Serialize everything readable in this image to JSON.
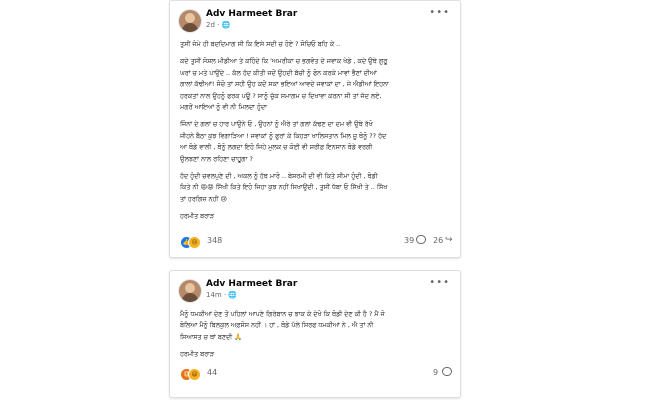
{
  "posts": [
    {
      "author": "Adv Harmeet Brar",
      "time": "2d",
      "audience_icon": "public-globe-icon",
      "lines": [
        "ਤੁਸੀਂ ਜੰਮੇ ਹੀ ਬਦਦਿਮਾਗ ਸੀ ਕਿ ਇਸੇ ਸਦੀ ਚ ਹੋਏ ? ਸੋਚਿਓ ਬਹਿ ਕੇ ..",
        "",
        "ਕਦੇ ਤੁਸੀਂ ਸੋਸ਼ਲ ਮੀਡੀਆ ਤੇ ਕਹਿੰਦੇ ਕਿ 'ਅਮਰੀਕਾ ਚ ਭਗਵੰਤ ਦੇ ਜਵਾਕ ਖੇਡੇ , ਕਦੇ ਉਥੇ ਗੁਰੂ",
        "ਘਰਾਂ ਚ ਮਤੇ ਪਾਉਂਦੇ .. ਕੱਲ ਹੱਦ ਕੀਤੀ ਜਦੋਂ ਉਹਦੀ ਬੱਚੀ ਨੂੰ ਫੋਨ ਕਰਕੇ ਮਾਵਾਂ ਭੈਣਾਂ ਦੀਆਂ",
        "ਗਾਲਾਂ ਕੱਢੀਆਂ! ਸੋਚੋ ਤਾਂ ਸਹੀ ਉਹ ਕਦੋਂ ਸਕਾ ਭਇਆਂ ਆਵਦੇ ਜਵਾਕਾਂ ਦਾ , ਜੇ ਐਡੀਆਂ ਇਹਨਾ",
        "ਹਰਕਤਾਂ ਨਾਲ ਉਹਨੂੰ ਫਰਕ ਪਊ ? ਸਾਨੂੰ ਚੁੱਕ ਸਮਾਗਮ ਚ ਦਿਖਾਵਾ ਕਰਨਾ ਸੀ ਤਾਂ ਜੱਦ ਲਏ,",
        "ਮਗਰੋਂ ਆਇਆਂ ਨੂੰ ਵੀ ਨੀ ਮਿਲਦਾ ਹੁੰਦਾ",
        "",
        "ਜਿੰਨਾਂ ਦੇ ਗਲਾਂ ਚ ਹਾਰ ਪਾਉਨੇ ਓ , ਉਹਨਾਂ ਨੂੰ ਐਰੇ ਤਾਂ ਗਲਾਂ ਕੱਢਣ ਦਾ ਦਮ ਵੀ ਉਥੇ ਰੱਖੋ",
        "ਜੀਹਨੇ ਬੈਠਾ ਕੁਝ ਵਿਗਾੜਿਆ ! ਜਵਾਕਾਂ ਨੂੰ ਫੁਰਾਂ ਕੇ ਕਿਹੜਾ ਖਾਲਿਸਤਾਨ ਮਿਲ ਜੂ ਥੋਨੂੰ ?? ਹੱਦ",
        "ਆ ਥੋਡੇ ਵਾਲੀ , ਥੋਨੂੰ ਲਗਦਾ ਇਹੋ ਜਿਹੇ ਮੁਲਕ ਚ ਕੋਈ ਵੀ ਸ਼ਰੀਫ਼ ਇਨਸਾਨ ਥੋਡੇ ਵਰਗੀ",
        "ਉਲਝਣਾਂ ਨਾਲ ਰਹਿਣਾ ਚਾਹੂਗਾ ?",
        "",
        "ਹੱਦ ਹੁੰਦੀ ਚਵਲਪੁਣੇ ਦੀ , ਅਕਲ ਨੂੰ ਹੱਥ ਮਾਰੋ .. ਬੇਸ਼ਰਮੀ ਦੀ ਵੀ ਕਿਤੇ ਸੀਮਾ ਹੁੰਦੀ , ਥੋਡੀ",
        "ਕਿਤੇ ਨੀ 😡😡 ਸਿੱਖੀ ਕਿਤੇ ਇਹੋ ਜਿਹਾ ਕੁਝ ਨਹੀਂ ਸਿਖਾਉਂਦੀ , ਤੁਸੀਂ ਧੱਬਾ ਓ ਸਿੱਖੀ ਤੇ .. ਸਿੱਖ",
        "ਤਾਂ ਹਰਗਿਜ਼ ਨਹੀਂ 😢",
        "",
        "ਹਰਮੀਤ ਬਰਾੜ"
      ],
      "reaction_icons": [
        "like-reaction-icon",
        "care-reaction-icon"
      ],
      "reaction_count": "348",
      "comment_count": "39",
      "share_count": "26"
    },
    {
      "author": "Adv Harmeet Brar",
      "time": "14m",
      "audience_icon": "public-globe-icon",
      "lines": [
        "ਮੈਨੂੰ ਧਮਕੀਆਂ ਦੇਣ ਤੋਂ ਪਹਿਲਾਂ ਆਪਣੇ ਗਿਰੇਬਾਨ ਚ ਝਾਕ ਕੇ ਦੇਖੋ ਕਿ ਥੋਡੀ ਦੇਣ ਕੀ ਹੈ ? ਮੈਂ ਜੋ",
        "ਬੋਲਿਆ ਮੈਨੂੰ ਬਿਲਕੁਲ ਅਫ਼ਸੋਸ ਨਹੀਂ । ਹਾਂ , ਥੋਡੇ ਪੱਲੇ ਸਿਰਫ ਧਮਕੀਆਂ ਨੇ , ਐ ਤਾਂ ਨੀ",
        "ਸਿਆਸਤ ਚ ਥਾਂ ਬਣਦੀ 🙏",
        "",
        "ਹਰਮੀਤ ਬਰਾੜ"
      ],
      "reaction_icons": [
        "angry-reaction-icon",
        "haha-reaction-icon"
      ],
      "reaction_count": "44",
      "comment_count": "9",
      "share_count": ""
    }
  ]
}
